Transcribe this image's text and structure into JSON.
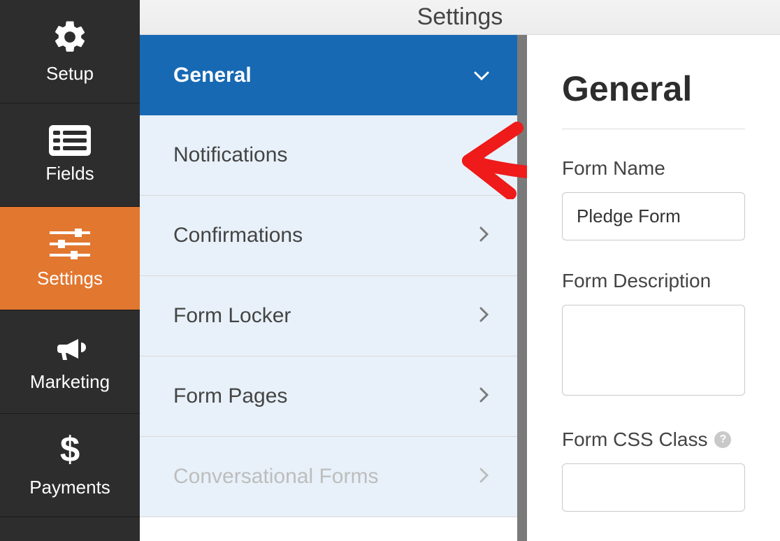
{
  "header": {
    "title": "Settings"
  },
  "sidebar": {
    "items": [
      {
        "label": "Setup"
      },
      {
        "label": "Fields"
      },
      {
        "label": "Settings"
      },
      {
        "label": "Marketing"
      },
      {
        "label": "Payments"
      }
    ]
  },
  "menu": {
    "header_label": "General",
    "items": [
      {
        "label": "Notifications"
      },
      {
        "label": "Confirmations"
      },
      {
        "label": "Form Locker"
      },
      {
        "label": "Form Pages"
      },
      {
        "label": "Conversational Forms",
        "disabled": true
      }
    ]
  },
  "form": {
    "heading": "General",
    "name_label": "Form Name",
    "name_value": "Pledge Form",
    "description_label": "Form Description",
    "description_value": "",
    "css_label": "Form CSS Class"
  }
}
